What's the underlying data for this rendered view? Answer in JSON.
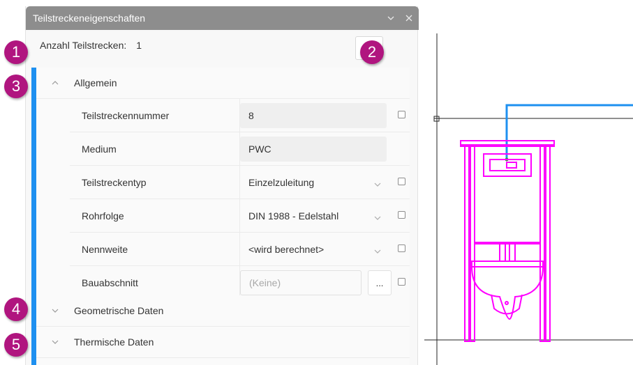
{
  "panel": {
    "title": "Teilstreckeneigenschaften",
    "count_label": "Anzahl Teilstrecken:",
    "count_value": "1"
  },
  "groups": {
    "allgemein": "Allgemein",
    "geometrisch": "Geometrische Daten",
    "thermisch": "Thermische Daten"
  },
  "properties": [
    {
      "name": "Teilstreckennummer",
      "value": "8"
    },
    {
      "name": "Medium",
      "value": "PWC"
    },
    {
      "name": "Teilstreckentyp",
      "value": "Einzelzuleitung"
    },
    {
      "name": "Rohrfolge",
      "value": "DIN 1988 - Edelstahl"
    },
    {
      "name": "Nennweite",
      "value": "<wird berechnet>"
    },
    {
      "name": "Bauabschnitt",
      "value": "(Keine)"
    }
  ],
  "dots_label": "...",
  "badges": [
    "1",
    "2",
    "3",
    "4",
    "5"
  ],
  "colors": {
    "accent": "#1e90f0",
    "badge": "#b0157f",
    "drawing_magenta": "#ff00ff",
    "drawing_pipe": "#1e90f0"
  }
}
